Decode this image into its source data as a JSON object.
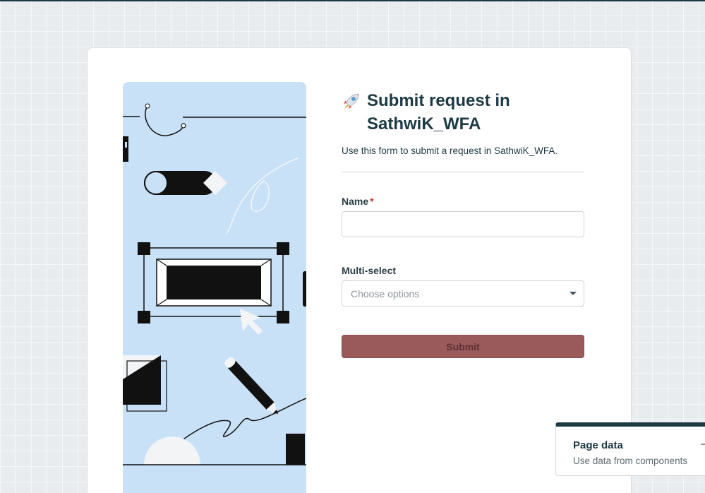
{
  "form": {
    "title_icon": "rocket-icon",
    "title": "Submit request in SathwiK_WFA",
    "subtitle": "Use this form to submit a request in SathwiK_WFA.",
    "fields": [
      {
        "label": "Name",
        "required": "*",
        "value": ""
      },
      {
        "label": "Multi-select",
        "placeholder": "Choose options"
      }
    ],
    "submit_label": "Submit"
  },
  "page_data_panel": {
    "title": "Page data",
    "subtitle": "Use data from components"
  },
  "colors": {
    "brand_dark": "#1c3a44",
    "submit_bg": "#9a5a5c",
    "required": "#c63b36",
    "illustration_bg": "#c8e1f6"
  }
}
